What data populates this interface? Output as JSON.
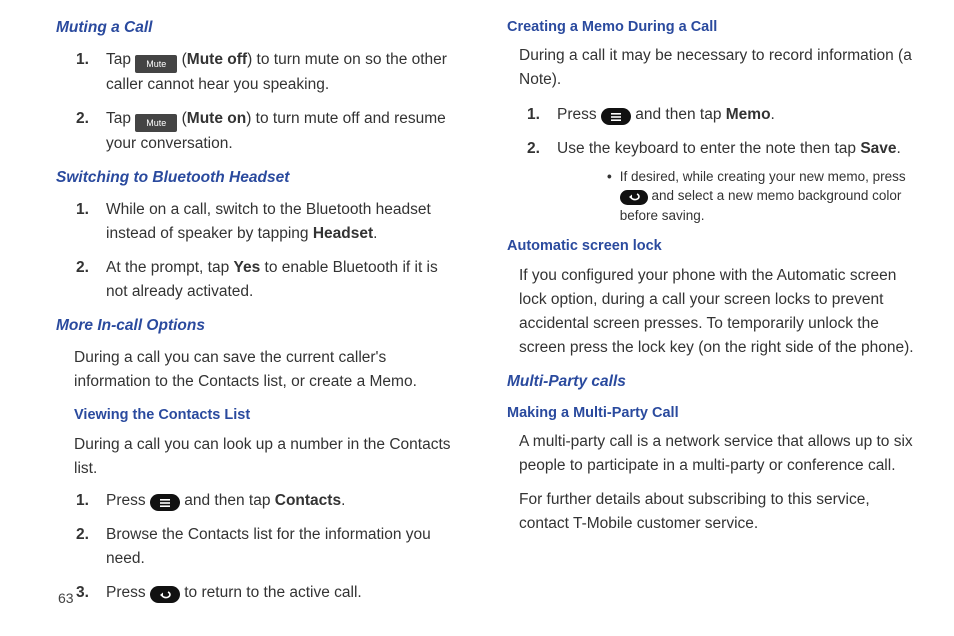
{
  "pageNumber": "63",
  "left": {
    "muting": {
      "heading": "Muting a Call",
      "step1": {
        "a": "Tap ",
        "btn": "Mute",
        "b": " (",
        "bold": "Mute off",
        "c": ") to turn mute on so the other caller cannot hear you speaking."
      },
      "step2": {
        "a": "Tap ",
        "btn": "Mute",
        "b": " (",
        "bold": "Mute on",
        "c": ") to turn mute off and resume your conversation."
      }
    },
    "bluetooth": {
      "heading": "Switching to Bluetooth Headset",
      "step1": {
        "a": "While on a call, switch to the Bluetooth headset instead of speaker by tapping ",
        "bold": "Headset",
        "b": "."
      },
      "step2": {
        "a": "At the prompt, tap ",
        "bold": "Yes",
        "b": " to enable Bluetooth if it is not already activated."
      }
    },
    "moreOptions": {
      "heading": "More In-call Options",
      "para": "During a call you can save the current caller's information to the Contacts list, or create a Memo."
    },
    "contacts": {
      "heading": "Viewing the Contacts List",
      "para": "During a call you can look up a number in the Contacts list.",
      "step1": {
        "a": "Press ",
        "b": " and then tap ",
        "bold": "Contacts",
        "c": "."
      },
      "step2": "Browse the Contacts list for the information you need.",
      "step3": {
        "a": "Press ",
        "b": " to return to the active call."
      }
    }
  },
  "right": {
    "memo": {
      "heading": "Creating a Memo During a Call",
      "para": "During a call it may be necessary to record information (a Note).",
      "step1": {
        "a": "Press ",
        "b": " and then tap ",
        "bold": "Memo",
        "c": "."
      },
      "step2": {
        "a": "Use the keyboard to enter the note then tap ",
        "bold": "Save",
        "b": "."
      },
      "bullet": {
        "a": "If desired, while creating your new memo, press ",
        "b": " and select a new memo background color before saving."
      }
    },
    "lock": {
      "heading": "Automatic screen lock",
      "para": "If you configured your phone with the Automatic screen lock option, during a call your screen locks to prevent accidental screen presses. To temporarily unlock the screen press the lock key (on the right side of the phone)."
    },
    "multi": {
      "heading": "Multi-Party calls",
      "subHeading": "Making a Multi-Party Call",
      "para1": "A multi-party call is a network service that allows up to six people to participate in a multi-party or conference call.",
      "para2": "For further details about subscribing to this service, contact T-Mobile customer service."
    }
  }
}
